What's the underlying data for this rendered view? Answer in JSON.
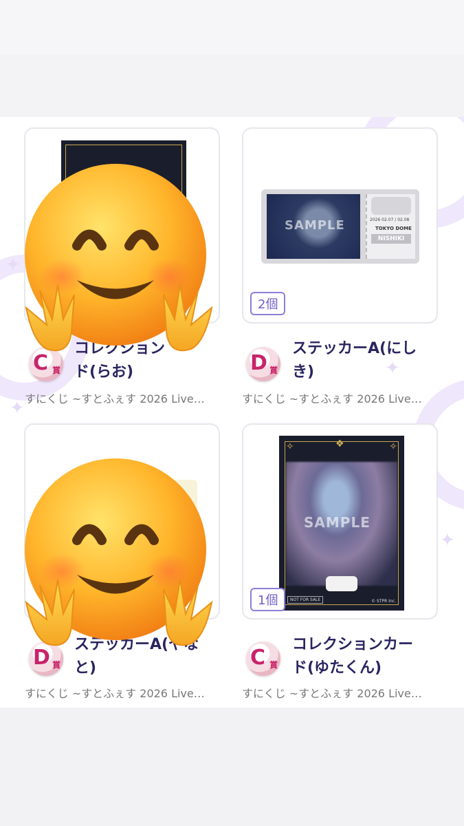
{
  "items": [
    {
      "prize_letter": "C",
      "prize_suffix": "賞",
      "name": "コレクションカード(らお)",
      "name_visible": "ド(らお)",
      "name_line1_visible": "コレクション",
      "subtitle": "すにくじ ~すとふぇす 2026 Live…",
      "quantity": "",
      "covered": true
    },
    {
      "prize_letter": "D",
      "prize_suffix": "賞",
      "name_line1": "ステッカーA(にし",
      "name_line2": "き)",
      "subtitle": "すにくじ ~すとふぇす 2026 Live…",
      "quantity": "2個",
      "ticket": {
        "sample": "SAMPLE",
        "date": "2026 02.07 / 02.08",
        "venue": "TOKYO DOME",
        "member": "NISHIKI"
      }
    },
    {
      "prize_letter": "D",
      "prize_suffix": "賞",
      "name_line1_visible": "ステッカーA(やな",
      "name_line2": "と)",
      "subtitle": "すにくじ ~すとふぇす 2026 Live…",
      "quantity": "",
      "covered": true
    },
    {
      "prize_letter": "C",
      "prize_suffix": "賞",
      "name_line1": "コレクションカー",
      "name_line2": "ド(ゆたくん)",
      "subtitle": "すにくじ ~すとふぇす 2026 Live…",
      "quantity": "1個",
      "card": {
        "sample": "SAMPLE",
        "not_for_sale": "NOT FOR SALE",
        "copyright": "© STPR Inc."
      }
    }
  ],
  "icons": {
    "cover": "smiling-face-with-open-hands-emoji"
  },
  "colors": {
    "accent": "#6d5fc9",
    "prize_badge": "#c8246a",
    "item_title": "#2a2560"
  }
}
